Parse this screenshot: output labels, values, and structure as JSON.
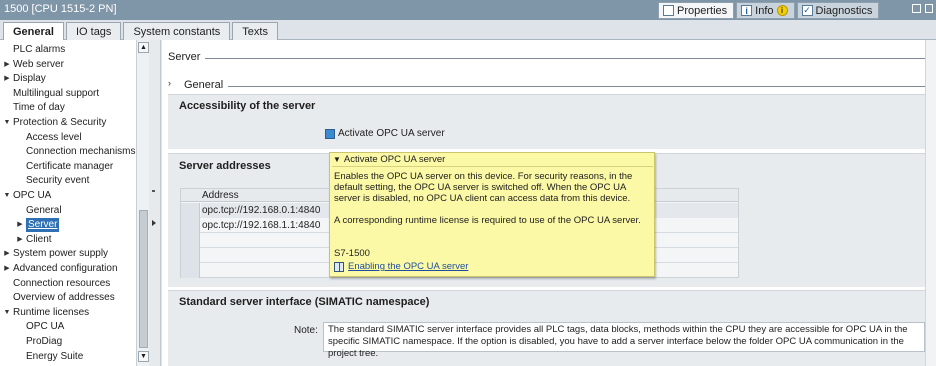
{
  "window": {
    "title": "1500 [CPU 1515-2 PN]"
  },
  "inspector_tabs": [
    {
      "label": "Properties",
      "active": true,
      "icon": "properties-icon"
    },
    {
      "label": "Info",
      "active": false,
      "icon": "info-icon",
      "badge": "i"
    },
    {
      "label": "Diagnostics",
      "active": false,
      "icon": "diagnostics-icon"
    }
  ],
  "tabs": [
    {
      "label": "General",
      "active": true
    },
    {
      "label": "IO tags",
      "active": false
    },
    {
      "label": "System constants",
      "active": false
    },
    {
      "label": "Texts",
      "active": false
    }
  ],
  "tree": [
    {
      "label": "PLC alarms",
      "level": 0,
      "arrow": ""
    },
    {
      "label": "Web server",
      "level": 0,
      "arrow": "right"
    },
    {
      "label": "Display",
      "level": 0,
      "arrow": "right"
    },
    {
      "label": "Multilingual support",
      "level": 0,
      "arrow": ""
    },
    {
      "label": "Time of day",
      "level": 0,
      "arrow": ""
    },
    {
      "label": "Protection & Security",
      "level": 0,
      "arrow": "down"
    },
    {
      "label": "Access level",
      "level": 1,
      "arrow": ""
    },
    {
      "label": "Connection mechanisms",
      "level": 1,
      "arrow": ""
    },
    {
      "label": "Certificate manager",
      "level": 1,
      "arrow": ""
    },
    {
      "label": "Security event",
      "level": 1,
      "arrow": ""
    },
    {
      "label": "OPC UA",
      "level": 0,
      "arrow": "down"
    },
    {
      "label": "General",
      "level": 1,
      "arrow": ""
    },
    {
      "label": "Server",
      "level": 1,
      "arrow": "right",
      "selected": true
    },
    {
      "label": "Client",
      "level": 1,
      "arrow": "right"
    },
    {
      "label": "System power supply",
      "level": 0,
      "arrow": "right"
    },
    {
      "label": "Advanced configuration",
      "level": 0,
      "arrow": "right"
    },
    {
      "label": "Connection resources",
      "level": 0,
      "arrow": ""
    },
    {
      "label": "Overview of addresses",
      "level": 0,
      "arrow": ""
    },
    {
      "label": "Runtime licenses",
      "level": 0,
      "arrow": "down"
    },
    {
      "label": "OPC UA",
      "level": 1,
      "arrow": ""
    },
    {
      "label": "ProDiag",
      "level": 1,
      "arrow": ""
    },
    {
      "label": "Energy Suite",
      "level": 1,
      "arrow": ""
    }
  ],
  "main": {
    "server_header": "Server",
    "general_header": "General",
    "accessibility_title": "Accessibility of the server",
    "activate_label": "Activate OPC UA server",
    "server_addresses_title": "Server addresses",
    "address_column": "Address",
    "addresses": [
      "opc.tcp://192.168.0.1:4840",
      "opc.tcp://192.168.1.1:4840"
    ],
    "standard_interface_title": "Standard server interface (SIMATIC namespace)",
    "note_label": "Note:",
    "note_text": "The standard SIMATIC server interface provides all PLC tags, data blocks, methods within the CPU they are accessible for OPC UA in the specific SIMATIC namespace. If the option is disabled, you have to add a server interface below the folder OPC UA communication in the project tree."
  },
  "tooltip": {
    "title": "Activate OPC UA server",
    "p1": "Enables the OPC UA server on this device. For security reasons, in the default setting, the OPC UA server is switched off. When the OPC UA server is disabled, no OPC UA client can access data from this device.",
    "p2": "A corresponding runtime license is required to use of the OPC UA server.",
    "cpu": "S7-1500",
    "link": "Enabling the OPC UA server"
  }
}
